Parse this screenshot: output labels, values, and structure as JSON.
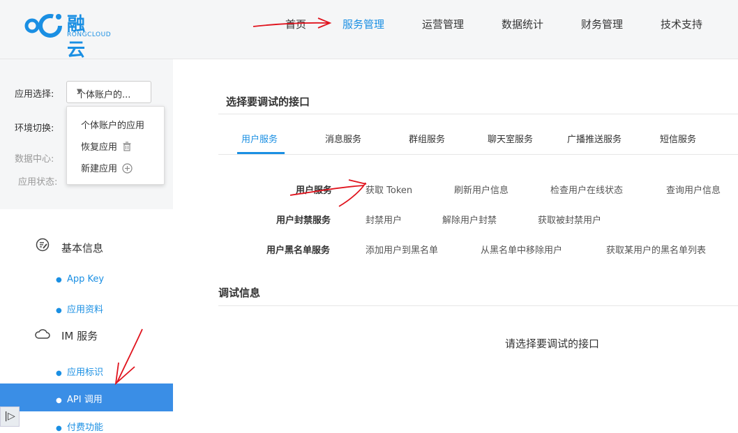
{
  "brand": {
    "name": "融 云",
    "sub": "RONGCLOUD",
    "color": "#1a8fe3"
  },
  "nav": {
    "items": [
      "首页",
      "服务管理",
      "运营管理",
      "数据统计",
      "财务管理",
      "技术支持"
    ],
    "active": "服务管理"
  },
  "sidebar": {
    "app_select_label": "应用选择:",
    "app_select_value": "个体账户的...",
    "env_label": "环境切换:",
    "datacenter_label": "数据中心:",
    "app_status_label": "应用状态:",
    "dropdown": [
      "个体账户的应用",
      "恢复应用",
      "新建应用"
    ],
    "menu": {
      "basic_info": "基本信息",
      "app_key": "App Key",
      "app_profile": "应用资料",
      "im_service": "IM 服务",
      "app_identity": "应用标识",
      "api_call": "API 调用",
      "paid_features": "付费功能"
    }
  },
  "main": {
    "select_api_title": "选择要调试的接口",
    "tabs": [
      "用户服务",
      "消息服务",
      "群组服务",
      "聊天室服务",
      "广播推送服务",
      "短信服务"
    ],
    "active_tab": "用户服务",
    "rows": [
      {
        "label": "用户服务",
        "apis": [
          "获取 Token",
          "刷新用户信息",
          "检查用户在线状态",
          "查询用户信息"
        ]
      },
      {
        "label": "用户封禁服务",
        "apis": [
          "封禁用户",
          "解除用户封禁",
          "获取被封禁用户"
        ]
      },
      {
        "label": "用户黑名单服务",
        "apis": [
          "添加用户到黑名单",
          "从黑名单中移除用户",
          "获取某用户的黑名单列表"
        ]
      }
    ],
    "debug_title": "调试信息",
    "debug_placeholder": "请选择要调试的接口"
  },
  "colors": {
    "accent": "#1a8fe3",
    "active_menu_bg": "#3a8ee6",
    "annotation": "#e0141e"
  }
}
